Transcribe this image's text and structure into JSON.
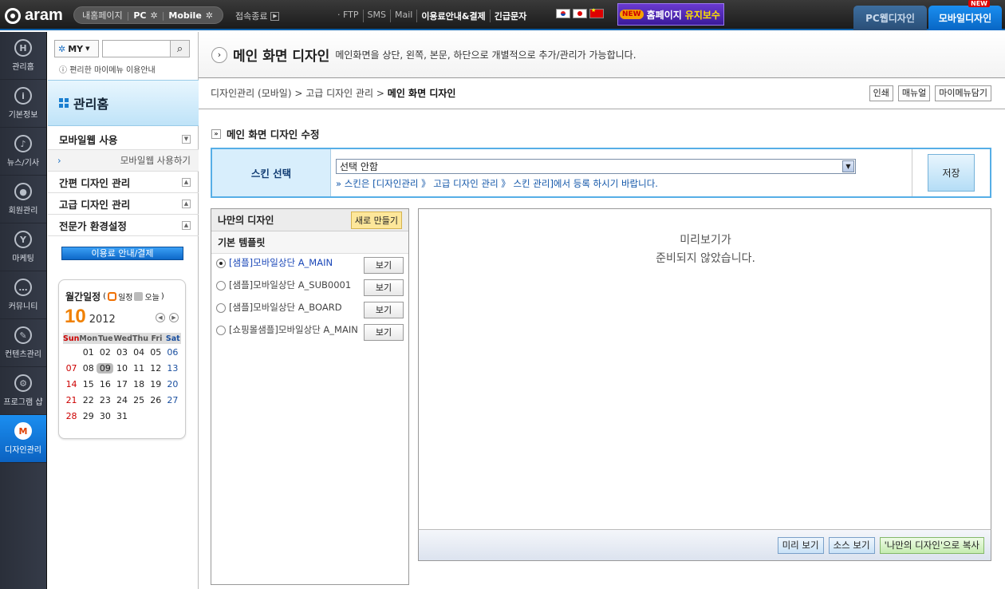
{
  "topbar": {
    "logo": "aram",
    "mypage": "내홈페이지",
    "pc": "PC",
    "mobile": "Mobile",
    "logout": "접속종료",
    "menu": [
      "FTP",
      "SMS",
      "Mail",
      "이용료안내&결제",
      "긴급문자"
    ],
    "maint_new": "NEW",
    "maint_a": "홈페이지 ",
    "maint_b": "유지보수",
    "tab_pc": "PC웹디자인",
    "tab_mobile": "모바일디자인",
    "tab_new": "NEW"
  },
  "rail": [
    "관리홈",
    "기본정보",
    "뉴스/기사",
    "회원관리",
    "마케팅",
    "커뮤니티",
    "컨텐츠관리",
    "프로그램 샵",
    "디자인관리"
  ],
  "side": {
    "my": "MY",
    "hint": "편리한 마이메뉴 이용안내",
    "title": "관리홈",
    "menu": [
      {
        "label": "모바일웹 사용",
        "toggle": "v"
      },
      {
        "label": "모바일웹 사용하기",
        "sub": true
      },
      {
        "label": "간편 디자인 관리",
        "toggle": "^"
      },
      {
        "label": "고급 디자인 관리",
        "toggle": "^"
      },
      {
        "label": "전문가 환경설정",
        "toggle": "^"
      }
    ],
    "pay": "이용료 안내/결제"
  },
  "calendar": {
    "title": "월간일정",
    "legend_event": "일정",
    "legend_today": "오늘",
    "month": "10",
    "year": "2012",
    "days": [
      "Sun",
      "Mon",
      "Tue",
      "Wed",
      "Thu",
      "Fri",
      "Sat"
    ],
    "weeks": [
      [
        "",
        "01",
        "02",
        "03",
        "04",
        "05",
        "06"
      ],
      [
        "07",
        "08",
        "09",
        "10",
        "11",
        "12",
        "13"
      ],
      [
        "14",
        "15",
        "16",
        "17",
        "18",
        "19",
        "20"
      ],
      [
        "21",
        "22",
        "23",
        "24",
        "25",
        "26",
        "27"
      ],
      [
        "28",
        "29",
        "30",
        "31",
        "",
        "",
        ""
      ]
    ],
    "today": "09"
  },
  "page": {
    "title": "메인 화면 디자인",
    "desc": "메인화면을 상단, 왼쪽, 본문, 하단으로 개별적으로 추가/관리가 가능합니다.",
    "breadcrumb": [
      "디자인관리 (모바일)",
      "고급 디자인 관리",
      "메인 화면 디자인"
    ],
    "tools": [
      "인쇄",
      "매뉴얼",
      "마이메뉴담기"
    ],
    "section": "메인 화면 디자인 수정"
  },
  "skin": {
    "label": "스킨 선택",
    "value": "선택 안함",
    "note": "» 스킨은 [디자인관리 》 고급 디자인 관리 》 스킨 관리]에서 등록 하시기 바랍니다.",
    "save": "저장"
  },
  "mydesign": {
    "title": "나만의 디자인",
    "new": "새로 만들기",
    "basic": "기본 템플릿",
    "view": "보기",
    "templates": [
      "[샘플]모바일상단 A_MAIN",
      "[샘플]모바일상단 A_SUB0001",
      "[샘플]모바일상단 A_BOARD",
      "[쇼핑몰샘플]모바일상단 A_MAIN"
    ]
  },
  "preview": {
    "line1": "미리보기가",
    "line2": "준비되지 않았습니다.",
    "buttons": [
      "미리 보기",
      "소스 보기",
      "'나만의 디자인'으로 복사"
    ]
  }
}
